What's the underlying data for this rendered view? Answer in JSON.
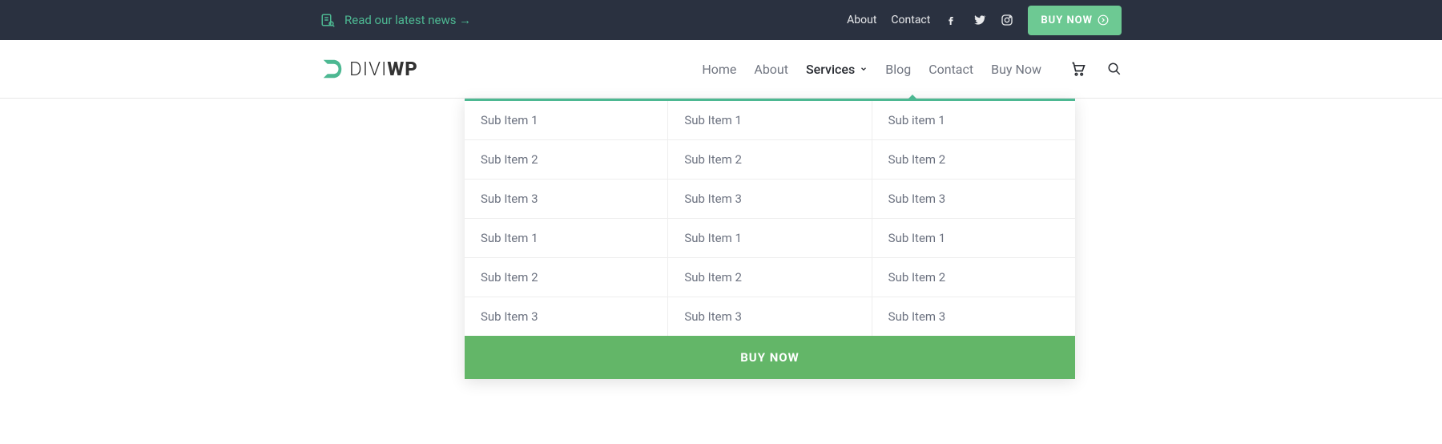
{
  "topbar": {
    "news_link": "Read our latest news →",
    "links": {
      "about": "About",
      "contact": "Contact"
    },
    "buy_button": "BUY NOW"
  },
  "logo": {
    "text1": "DIVI",
    "text2": "WP"
  },
  "nav": {
    "home": "Home",
    "about": "About",
    "services": "Services",
    "blog": "Blog",
    "contact": "Contact",
    "buy_now": "Buy Now"
  },
  "mega": {
    "cols": [
      [
        "Sub Item 1",
        "Sub Item 2",
        "Sub Item 3",
        "Sub Item 1",
        "Sub Item 2",
        "Sub Item 3"
      ],
      [
        "Sub Item 1",
        "Sub Item 2",
        "Sub Item 3",
        "Sub Item 1",
        "Sub Item 2",
        "Sub Item 3"
      ],
      [
        "Sub item 1",
        "Sub Item 2",
        "Sub Item 3",
        "Sub Item 1",
        "Sub Item 2",
        "Sub Item 3"
      ]
    ],
    "cta": "BUY NOW"
  }
}
